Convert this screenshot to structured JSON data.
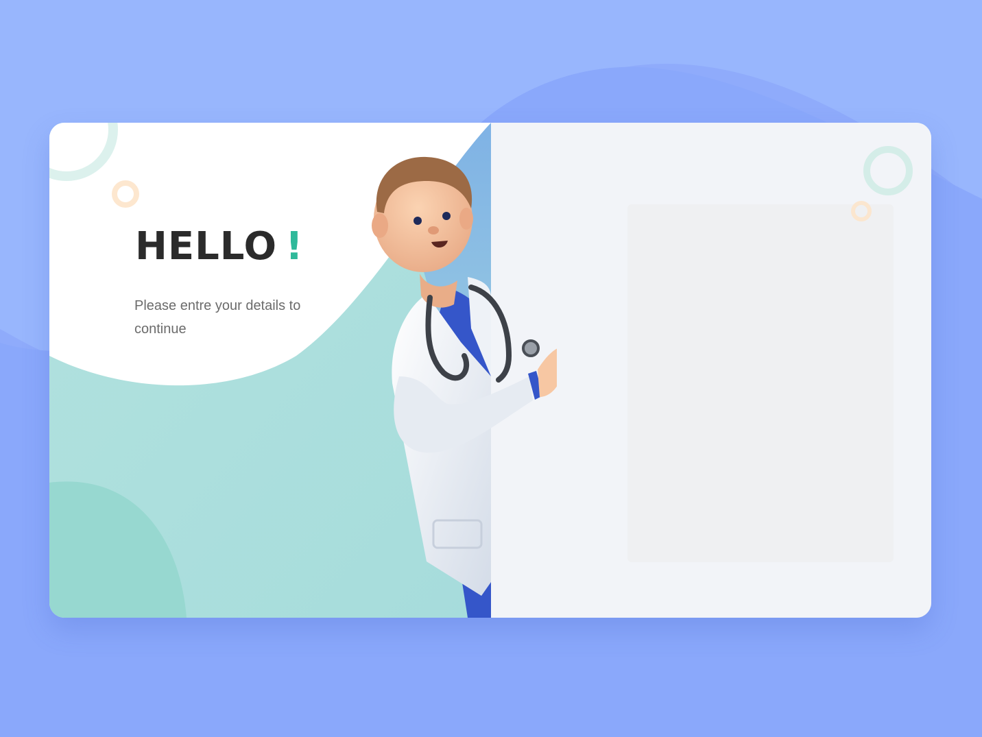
{
  "greeting": {
    "title": "HELLO",
    "exclamation": "!",
    "subtitle": "Please entre your details to continue"
  },
  "icons": {
    "ring_topleft": "ring-icon",
    "ring_small_orange": "ring-icon",
    "ring_topright": "ring-icon",
    "doctor": "doctor-illustration"
  },
  "colors": {
    "page_background": "#8fabfb",
    "accent_green": "#2fb99a",
    "teal_panel": "#aee0de",
    "right_panel": "#f2f4f8"
  }
}
